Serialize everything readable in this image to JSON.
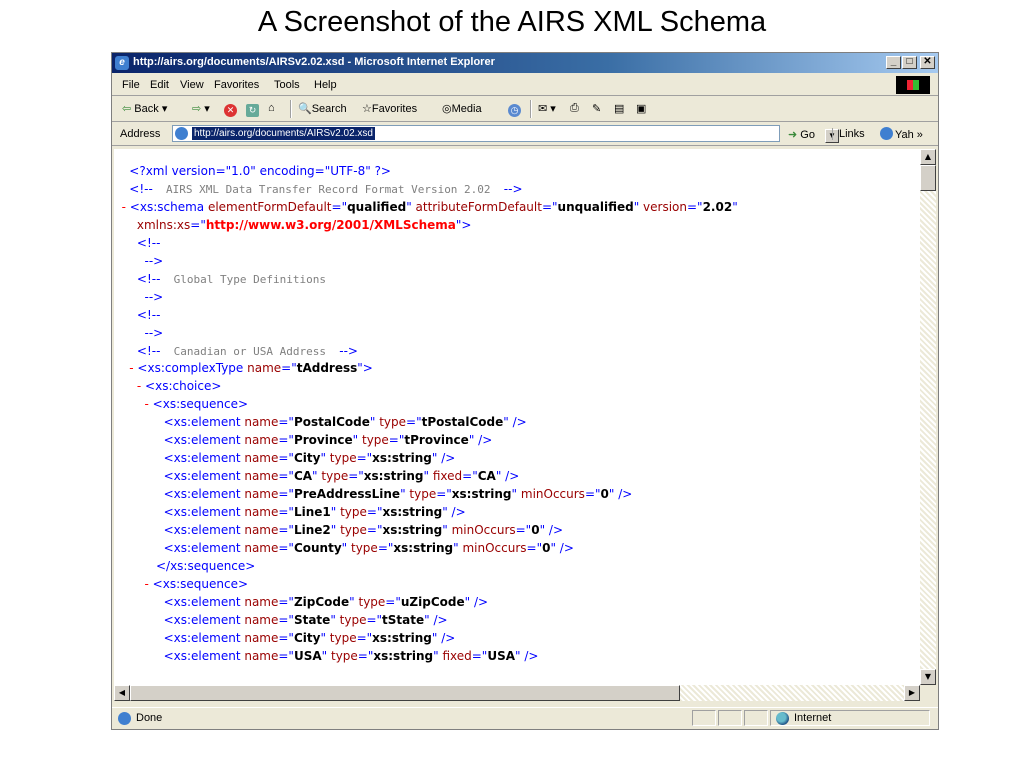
{
  "slide_title": "A Screenshot of the AIRS XML Schema",
  "window": {
    "title": "http://airs.org/documents/AIRSv2.02.xsd - Microsoft Internet Explorer",
    "minimize_glyph": "_",
    "maximize_glyph": "□",
    "close_glyph": "✕"
  },
  "menu": [
    "File",
    "Edit",
    "View",
    "Favorites",
    "Tools",
    "Help"
  ],
  "toolbar": {
    "back": "Back",
    "search": "Search",
    "favorites": "Favorites",
    "media": "Media"
  },
  "address": {
    "label": "Address",
    "value": "http://airs.org/documents/AIRSv2.02.xsd",
    "go": "Go",
    "links": "Links",
    "yahoo": "Yah »"
  },
  "xml_lines": [
    {
      "pre": "    ",
      "parts": [
        {
          "t": "<?xml version=\"1.0\" encoding=\"UTF-8\" ?>",
          "c": ""
        }
      ]
    },
    {
      "pre": "    ",
      "parts": [
        {
          "t": "<!--",
          "c": ""
        },
        {
          "t": "  AIRS XML Data Transfer Record Format Version 2.02  ",
          "c": "cm"
        },
        {
          "t": "-->",
          "c": ""
        }
      ]
    },
    {
      "pre": "  ",
      "parts": [
        {
          "t": "- ",
          "c": "m"
        },
        {
          "t": "<xs:schema ",
          "c": ""
        },
        {
          "t": "elementFormDefault",
          "c": "a"
        },
        {
          "t": "=\"",
          "c": ""
        },
        {
          "t": "qualified",
          "c": "v"
        },
        {
          "t": "\" ",
          "c": ""
        },
        {
          "t": "attributeFormDefault",
          "c": "a"
        },
        {
          "t": "=\"",
          "c": ""
        },
        {
          "t": "unqualified",
          "c": "v"
        },
        {
          "t": "\" ",
          "c": ""
        },
        {
          "t": "version",
          "c": "a"
        },
        {
          "t": "=\"",
          "c": ""
        },
        {
          "t": "2.02",
          "c": "v"
        },
        {
          "t": "\"",
          "c": ""
        }
      ]
    },
    {
      "pre": "      ",
      "parts": [
        {
          "t": "xmlns:xs",
          "c": "a"
        },
        {
          "t": "=\"",
          "c": ""
        },
        {
          "t": "http://www.w3.org/2001/XMLSchema",
          "c": "vr"
        },
        {
          "t": "\">",
          "c": ""
        }
      ]
    },
    {
      "pre": "      ",
      "parts": [
        {
          "t": "<!--",
          "c": ""
        }
      ]
    },
    {
      "pre": "        ",
      "parts": [
        {
          "t": "-->",
          "c": ""
        }
      ]
    },
    {
      "pre": "      ",
      "parts": [
        {
          "t": "<!--",
          "c": ""
        },
        {
          "t": "  Global Type Definitions",
          "c": "cm"
        }
      ]
    },
    {
      "pre": "        ",
      "parts": [
        {
          "t": "-->",
          "c": ""
        }
      ]
    },
    {
      "pre": "      ",
      "parts": [
        {
          "t": "<!--",
          "c": ""
        }
      ]
    },
    {
      "pre": "        ",
      "parts": [
        {
          "t": "-->",
          "c": ""
        }
      ]
    },
    {
      "pre": "      ",
      "parts": [
        {
          "t": "<!--",
          "c": ""
        },
        {
          "t": "  Canadian or USA Address  ",
          "c": "cm"
        },
        {
          "t": "-->",
          "c": ""
        }
      ]
    },
    {
      "pre": "    ",
      "parts": [
        {
          "t": "- ",
          "c": "m"
        },
        {
          "t": "<xs:complexType ",
          "c": ""
        },
        {
          "t": "name",
          "c": "a"
        },
        {
          "t": "=\"",
          "c": ""
        },
        {
          "t": "tAddress",
          "c": "v"
        },
        {
          "t": "\">",
          "c": ""
        }
      ]
    },
    {
      "pre": "      ",
      "parts": [
        {
          "t": "- ",
          "c": "m"
        },
        {
          "t": "<xs:choice>",
          "c": ""
        }
      ]
    },
    {
      "pre": "        ",
      "parts": [
        {
          "t": "- ",
          "c": "m"
        },
        {
          "t": "<xs:sequence>",
          "c": ""
        }
      ]
    },
    {
      "pre": "             ",
      "parts": [
        {
          "t": "<xs:element ",
          "c": ""
        },
        {
          "t": "name",
          "c": "a"
        },
        {
          "t": "=\"",
          "c": ""
        },
        {
          "t": "PostalCode",
          "c": "v"
        },
        {
          "t": "\" ",
          "c": ""
        },
        {
          "t": "type",
          "c": "a"
        },
        {
          "t": "=\"",
          "c": ""
        },
        {
          "t": "tPostalCode",
          "c": "v"
        },
        {
          "t": "\" />",
          "c": ""
        }
      ]
    },
    {
      "pre": "             ",
      "parts": [
        {
          "t": "<xs:element ",
          "c": ""
        },
        {
          "t": "name",
          "c": "a"
        },
        {
          "t": "=\"",
          "c": ""
        },
        {
          "t": "Province",
          "c": "v"
        },
        {
          "t": "\" ",
          "c": ""
        },
        {
          "t": "type",
          "c": "a"
        },
        {
          "t": "=\"",
          "c": ""
        },
        {
          "t": "tProvince",
          "c": "v"
        },
        {
          "t": "\" />",
          "c": ""
        }
      ]
    },
    {
      "pre": "             ",
      "parts": [
        {
          "t": "<xs:element ",
          "c": ""
        },
        {
          "t": "name",
          "c": "a"
        },
        {
          "t": "=\"",
          "c": ""
        },
        {
          "t": "City",
          "c": "v"
        },
        {
          "t": "\" ",
          "c": ""
        },
        {
          "t": "type",
          "c": "a"
        },
        {
          "t": "=\"",
          "c": ""
        },
        {
          "t": "xs:string",
          "c": "v"
        },
        {
          "t": "\" />",
          "c": ""
        }
      ]
    },
    {
      "pre": "             ",
      "parts": [
        {
          "t": "<xs:element ",
          "c": ""
        },
        {
          "t": "name",
          "c": "a"
        },
        {
          "t": "=\"",
          "c": ""
        },
        {
          "t": "CA",
          "c": "v"
        },
        {
          "t": "\" ",
          "c": ""
        },
        {
          "t": "type",
          "c": "a"
        },
        {
          "t": "=\"",
          "c": ""
        },
        {
          "t": "xs:string",
          "c": "v"
        },
        {
          "t": "\" ",
          "c": ""
        },
        {
          "t": "fixed",
          "c": "a"
        },
        {
          "t": "=\"",
          "c": ""
        },
        {
          "t": "CA",
          "c": "v"
        },
        {
          "t": "\" />",
          "c": ""
        }
      ]
    },
    {
      "pre": "             ",
      "parts": [
        {
          "t": "<xs:element ",
          "c": ""
        },
        {
          "t": "name",
          "c": "a"
        },
        {
          "t": "=\"",
          "c": ""
        },
        {
          "t": "PreAddressLine",
          "c": "v"
        },
        {
          "t": "\" ",
          "c": ""
        },
        {
          "t": "type",
          "c": "a"
        },
        {
          "t": "=\"",
          "c": ""
        },
        {
          "t": "xs:string",
          "c": "v"
        },
        {
          "t": "\" ",
          "c": ""
        },
        {
          "t": "minOccurs",
          "c": "a"
        },
        {
          "t": "=\"",
          "c": ""
        },
        {
          "t": "0",
          "c": "v"
        },
        {
          "t": "\" />",
          "c": ""
        }
      ]
    },
    {
      "pre": "             ",
      "parts": [
        {
          "t": "<xs:element ",
          "c": ""
        },
        {
          "t": "name",
          "c": "a"
        },
        {
          "t": "=\"",
          "c": ""
        },
        {
          "t": "Line1",
          "c": "v"
        },
        {
          "t": "\" ",
          "c": ""
        },
        {
          "t": "type",
          "c": "a"
        },
        {
          "t": "=\"",
          "c": ""
        },
        {
          "t": "xs:string",
          "c": "v"
        },
        {
          "t": "\" />",
          "c": ""
        }
      ]
    },
    {
      "pre": "             ",
      "parts": [
        {
          "t": "<xs:element ",
          "c": ""
        },
        {
          "t": "name",
          "c": "a"
        },
        {
          "t": "=\"",
          "c": ""
        },
        {
          "t": "Line2",
          "c": "v"
        },
        {
          "t": "\" ",
          "c": ""
        },
        {
          "t": "type",
          "c": "a"
        },
        {
          "t": "=\"",
          "c": ""
        },
        {
          "t": "xs:string",
          "c": "v"
        },
        {
          "t": "\" ",
          "c": ""
        },
        {
          "t": "minOccurs",
          "c": "a"
        },
        {
          "t": "=\"",
          "c": ""
        },
        {
          "t": "0",
          "c": "v"
        },
        {
          "t": "\" />",
          "c": ""
        }
      ]
    },
    {
      "pre": "             ",
      "parts": [
        {
          "t": "<xs:element ",
          "c": ""
        },
        {
          "t": "name",
          "c": "a"
        },
        {
          "t": "=\"",
          "c": ""
        },
        {
          "t": "County",
          "c": "v"
        },
        {
          "t": "\" ",
          "c": ""
        },
        {
          "t": "type",
          "c": "a"
        },
        {
          "t": "=\"",
          "c": ""
        },
        {
          "t": "xs:string",
          "c": "v"
        },
        {
          "t": "\" ",
          "c": ""
        },
        {
          "t": "minOccurs",
          "c": "a"
        },
        {
          "t": "=\"",
          "c": ""
        },
        {
          "t": "0",
          "c": "v"
        },
        {
          "t": "\" />",
          "c": ""
        }
      ]
    },
    {
      "pre": "           ",
      "parts": [
        {
          "t": "</xs:sequence>",
          "c": ""
        }
      ]
    },
    {
      "pre": "        ",
      "parts": [
        {
          "t": "- ",
          "c": "m"
        },
        {
          "t": "<xs:sequence>",
          "c": ""
        }
      ]
    },
    {
      "pre": "             ",
      "parts": [
        {
          "t": "<xs:element ",
          "c": ""
        },
        {
          "t": "name",
          "c": "a"
        },
        {
          "t": "=\"",
          "c": ""
        },
        {
          "t": "ZipCode",
          "c": "v"
        },
        {
          "t": "\" ",
          "c": ""
        },
        {
          "t": "type",
          "c": "a"
        },
        {
          "t": "=\"",
          "c": ""
        },
        {
          "t": "uZipCode",
          "c": "v"
        },
        {
          "t": "\" />",
          "c": ""
        }
      ]
    },
    {
      "pre": "             ",
      "parts": [
        {
          "t": "<xs:element ",
          "c": ""
        },
        {
          "t": "name",
          "c": "a"
        },
        {
          "t": "=\"",
          "c": ""
        },
        {
          "t": "State",
          "c": "v"
        },
        {
          "t": "\" ",
          "c": ""
        },
        {
          "t": "type",
          "c": "a"
        },
        {
          "t": "=\"",
          "c": ""
        },
        {
          "t": "tState",
          "c": "v"
        },
        {
          "t": "\" />",
          "c": ""
        }
      ]
    },
    {
      "pre": "             ",
      "parts": [
        {
          "t": "<xs:element ",
          "c": ""
        },
        {
          "t": "name",
          "c": "a"
        },
        {
          "t": "=\"",
          "c": ""
        },
        {
          "t": "City",
          "c": "v"
        },
        {
          "t": "\" ",
          "c": ""
        },
        {
          "t": "type",
          "c": "a"
        },
        {
          "t": "=\"",
          "c": ""
        },
        {
          "t": "xs:string",
          "c": "v"
        },
        {
          "t": "\" />",
          "c": ""
        }
      ]
    },
    {
      "pre": "             ",
      "parts": [
        {
          "t": "<xs:element ",
          "c": ""
        },
        {
          "t": "name",
          "c": "a"
        },
        {
          "t": "=\"",
          "c": ""
        },
        {
          "t": "USA",
          "c": "v"
        },
        {
          "t": "\" ",
          "c": ""
        },
        {
          "t": "type",
          "c": "a"
        },
        {
          "t": "=\"",
          "c": ""
        },
        {
          "t": "xs:string",
          "c": "v"
        },
        {
          "t": "\" ",
          "c": ""
        },
        {
          "t": "fixed",
          "c": "a"
        },
        {
          "t": "=\"",
          "c": ""
        },
        {
          "t": "USA",
          "c": "v"
        },
        {
          "t": "\" />",
          "c": ""
        }
      ]
    }
  ],
  "status": {
    "text": "Done",
    "zone": "Internet"
  },
  "colors": {
    "xml_markup": "#0000ff",
    "xml_attribute": "#990000",
    "xml_collapse_marker": "#ff0000",
    "xml_comment": "#808080",
    "title_bar": "#0a246a"
  }
}
